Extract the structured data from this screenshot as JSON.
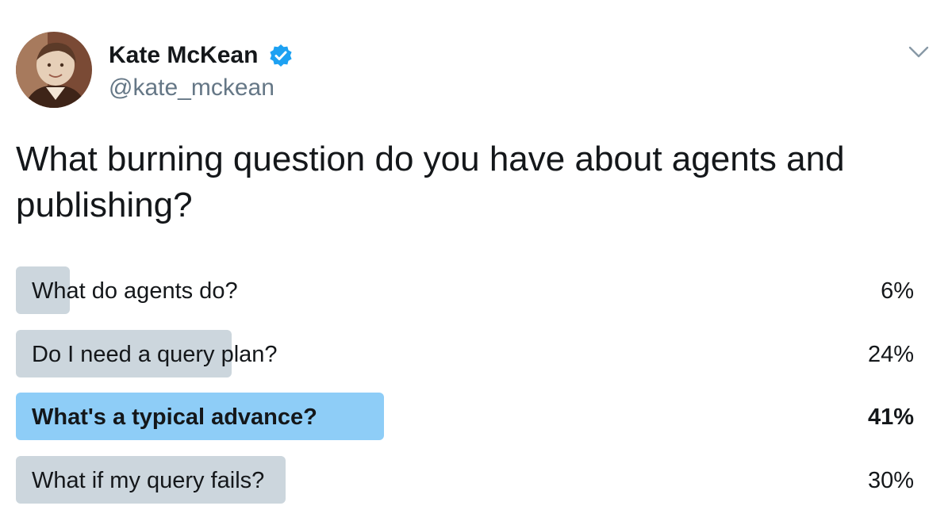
{
  "author": {
    "name": "Kate McKean",
    "handle": "@kate_mckean",
    "verified": true,
    "verified_icon": "verified-badge-icon"
  },
  "more_icon": "chevron-down-icon",
  "tweet": {
    "text": "What burning question do you have about agents and publishing?"
  },
  "poll": {
    "choices": [
      {
        "label": "What do agents do?",
        "percent": "6%",
        "value": 6,
        "leading": false
      },
      {
        "label": "Do I need a query plan?",
        "percent": "24%",
        "value": 24,
        "leading": false
      },
      {
        "label": "What's a typical advance?",
        "percent": "41%",
        "value": 41,
        "leading": true
      },
      {
        "label": "What if my query fails?",
        "percent": "30%",
        "value": 30,
        "leading": false
      }
    ]
  },
  "colors": {
    "accent": "#1da1f2",
    "bar": "#ccd6dd",
    "bar_leading": "#8ecdf7",
    "handle": "#657786",
    "text": "#14171a"
  }
}
